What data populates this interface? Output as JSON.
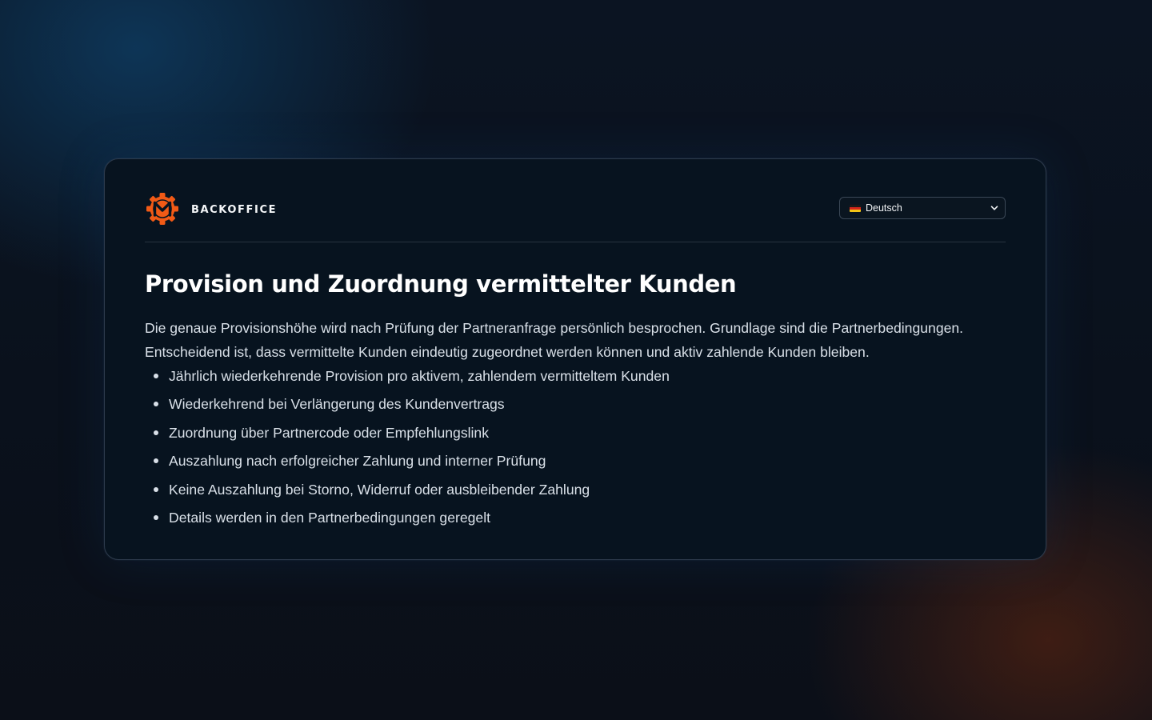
{
  "brand": {
    "logo_icon": "gear-m-logo-icon",
    "name": "BACKOFFICE",
    "accent_color": "#f15a16"
  },
  "language": {
    "flag_icon": "german-flag-icon",
    "selected": "Deutsch"
  },
  "content": {
    "title": "Provision und Zuordnung vermittelter Kunden",
    "intro_line_1": "Die genaue Provisionshöhe wird nach Prüfung der Partneranfrage persönlich besprochen. Grundlage sind die Partnerbedingungen.",
    "intro_line_2": "Entscheidend ist, dass vermittelte Kunden eindeutig zugeordnet werden können und aktiv zahlende Kunden bleiben.",
    "features": [
      "Jährlich wiederkehrende Provision pro aktivem, zahlendem vermitteltem Kunden",
      "Wiederkehrend bei Verlängerung des Kundenvertrags",
      "Zuordnung über Partnercode oder Empfehlungslink",
      "Auszahlung nach erfolgreicher Zahlung und interner Prüfung",
      "Keine Auszahlung bei Storno, Widerruf oder ausbleibender Zahlung",
      "Details werden in den Partnerbedingungen geregelt"
    ]
  }
}
